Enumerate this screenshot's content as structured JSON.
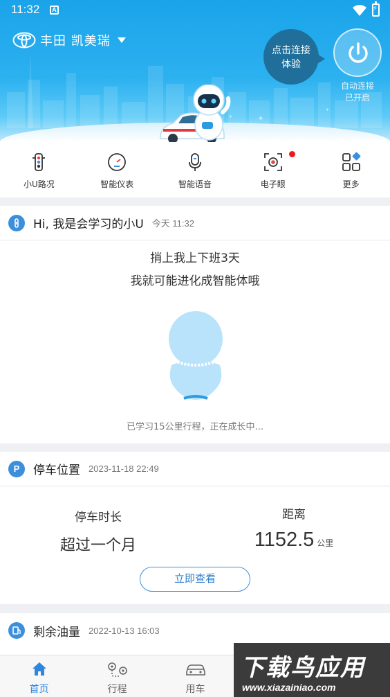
{
  "status_bar": {
    "time": "11:32",
    "notification_glyph": "A"
  },
  "header": {
    "brand_logo": "toyota-logo-icon",
    "car_name": "丰田 凯美瑞",
    "connect_bubble": {
      "line1": "点击连接",
      "line2": "体验"
    },
    "auto_connect": {
      "line1": "自动连接",
      "line2": "已开启"
    }
  },
  "quick_menu": [
    {
      "label": "小U路况",
      "icon": "traffic-light-icon"
    },
    {
      "label": "智能仪表",
      "icon": "gauge-icon"
    },
    {
      "label": "智能语音",
      "icon": "microphone-icon"
    },
    {
      "label": "电子眼",
      "icon": "camera-icon",
      "badge": "red-dot"
    },
    {
      "label": "更多",
      "icon": "more-grid-icon"
    }
  ],
  "learning_card": {
    "title": "Hi, 我是会学习的小U",
    "time": "今天 11:32",
    "line1": "捎上我上下班3天",
    "line2": "我就可能进化成智能体哦",
    "progress": "已学习15公里行程，正在成长中..."
  },
  "parking_card": {
    "title": "停车位置",
    "time": "2023-11-18 22:49",
    "duration_label": "停车时长",
    "duration_value": "超过一个月",
    "distance_label": "距离",
    "distance_value": "1152.5",
    "distance_unit": "公里",
    "view_button": "立即查看"
  },
  "fuel_card": {
    "title": "剩余油量",
    "time": "2022-10-13 16:03"
  },
  "bottom_nav": [
    {
      "label": "首页",
      "icon": "home-icon",
      "active": true
    },
    {
      "label": "行程",
      "icon": "route-icon",
      "active": false
    },
    {
      "label": "用车",
      "icon": "car-icon",
      "active": false
    }
  ],
  "watermark": {
    "big": "下载鸟应用",
    "small": "www.xiazainiao.com"
  },
  "colors": {
    "header": "#1aa3ea",
    "accent": "#2f86dc",
    "badge": "#f01818"
  }
}
